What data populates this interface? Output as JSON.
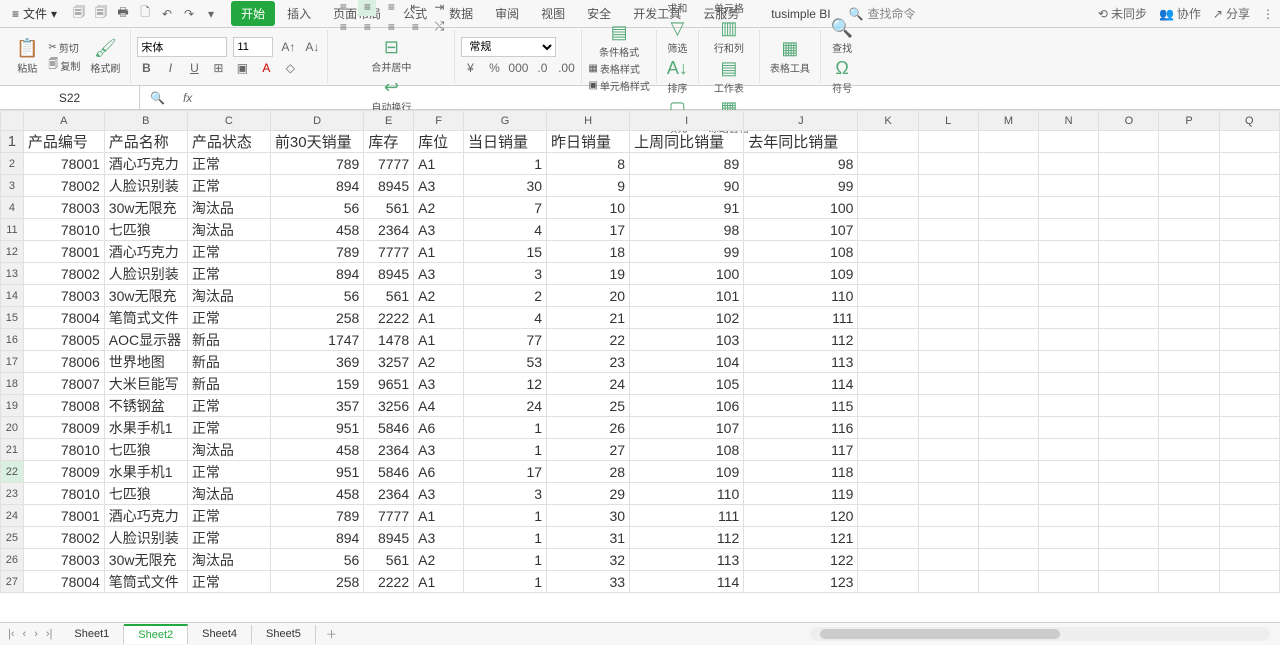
{
  "menubar": {
    "file": "文件",
    "tabs": [
      "开始",
      "插入",
      "页面布局",
      "公式",
      "数据",
      "审阅",
      "视图",
      "安全",
      "开发工具",
      "云服务"
    ],
    "active_tab": 0,
    "ext": "tusimple BI",
    "search_placeholder": "查找命令",
    "right": {
      "nosync": "未同步",
      "collab": "协作",
      "share": "分享"
    }
  },
  "ribbon": {
    "paste": "粘贴",
    "cut": "剪切",
    "copy": "复制",
    "fmtpaint": "格式刷",
    "fontname": "宋体",
    "fontsize": "11",
    "merge": "合并居中",
    "wrap": "自动换行",
    "numfmt": "常规",
    "condfmt": "条件格式",
    "tablestyle": "表格样式",
    "cellstyle": "单元格样式",
    "sum": "求和",
    "filter": "筛选",
    "sort": "排序",
    "fill": "填充",
    "cells": "单元格",
    "rowcol": "行和列",
    "worksheet": "工作表",
    "freeze": "冻结窗格",
    "tabletool": "表格工具",
    "find": "查找",
    "symbol": "符号"
  },
  "namebar": {
    "cellref": "S22"
  },
  "columns": [
    "A",
    "B",
    "C",
    "D",
    "E",
    "F",
    "G",
    "H",
    "I",
    "J",
    "K",
    "L",
    "M",
    "N",
    "O",
    "P",
    "Q"
  ],
  "header_row": [
    "产品编号",
    "产品名称",
    "产品状态",
    "前30天销量",
    "库存",
    "库位",
    "当日销量",
    "昨日销量",
    "上周同比销量",
    "去年同比销量"
  ],
  "row_numbers": [
    1,
    2,
    3,
    4,
    11,
    12,
    13,
    14,
    15,
    16,
    17,
    18,
    19,
    20,
    21,
    22,
    23,
    24,
    25,
    26,
    27
  ],
  "rows": [
    [
      "78001",
      "酒心巧克力",
      "正常",
      "789",
      "7777",
      "A1",
      "1",
      "8",
      "89",
      "98"
    ],
    [
      "78002",
      "人脸识别装",
      "正常",
      "894",
      "8945",
      "A3",
      "30",
      "9",
      "90",
      "99"
    ],
    [
      "78003",
      "30w无限充",
      "淘汰品",
      "56",
      "561",
      "A2",
      "7",
      "10",
      "91",
      "100"
    ],
    [
      "78010",
      "七匹狼",
      "淘汰品",
      "458",
      "2364",
      "A3",
      "4",
      "17",
      "98",
      "107"
    ],
    [
      "78001",
      "酒心巧克力",
      "正常",
      "789",
      "7777",
      "A1",
      "15",
      "18",
      "99",
      "108"
    ],
    [
      "78002",
      "人脸识别装",
      "正常",
      "894",
      "8945",
      "A3",
      "3",
      "19",
      "100",
      "109"
    ],
    [
      "78003",
      "30w无限充",
      "淘汰品",
      "56",
      "561",
      "A2",
      "2",
      "20",
      "101",
      "110"
    ],
    [
      "78004",
      "笔筒式文件",
      "正常",
      "258",
      "2222",
      "A1",
      "4",
      "21",
      "102",
      "111"
    ],
    [
      "78005",
      "AOC显示器",
      "新品",
      "1747",
      "1478",
      "A1",
      "77",
      "22",
      "103",
      "112"
    ],
    [
      "78006",
      "世界地图",
      "新品",
      "369",
      "3257",
      "A2",
      "53",
      "23",
      "104",
      "113"
    ],
    [
      "78007",
      "大米巨能写",
      "新品",
      "159",
      "9651",
      "A3",
      "12",
      "24",
      "105",
      "114"
    ],
    [
      "78008",
      "不锈钢盆",
      "正常",
      "357",
      "3256",
      "A4",
      "24",
      "25",
      "106",
      "115"
    ],
    [
      "78009",
      "水果手机1",
      "正常",
      "951",
      "5846",
      "A6",
      "1",
      "26",
      "107",
      "116"
    ],
    [
      "78010",
      "七匹狼",
      "淘汰品",
      "458",
      "2364",
      "A3",
      "1",
      "27",
      "108",
      "117"
    ],
    [
      "78009",
      "水果手机1",
      "正常",
      "951",
      "5846",
      "A6",
      "17",
      "28",
      "109",
      "118"
    ],
    [
      "78010",
      "七匹狼",
      "淘汰品",
      "458",
      "2364",
      "A3",
      "3",
      "29",
      "110",
      "119"
    ],
    [
      "78001",
      "酒心巧克力",
      "正常",
      "789",
      "7777",
      "A1",
      "1",
      "30",
      "111",
      "120"
    ],
    [
      "78002",
      "人脸识别装",
      "正常",
      "894",
      "8945",
      "A3",
      "1",
      "31",
      "112",
      "121"
    ],
    [
      "78003",
      "30w无限充",
      "淘汰品",
      "56",
      "561",
      "A2",
      "1",
      "32",
      "113",
      "122"
    ],
    [
      "78004",
      "笔筒式文件",
      "正常",
      "258",
      "2222",
      "A1",
      "1",
      "33",
      "114",
      "123"
    ]
  ],
  "sheets": [
    "Sheet1",
    "Sheet2",
    "Sheet4",
    "Sheet5"
  ],
  "active_sheet": 1
}
